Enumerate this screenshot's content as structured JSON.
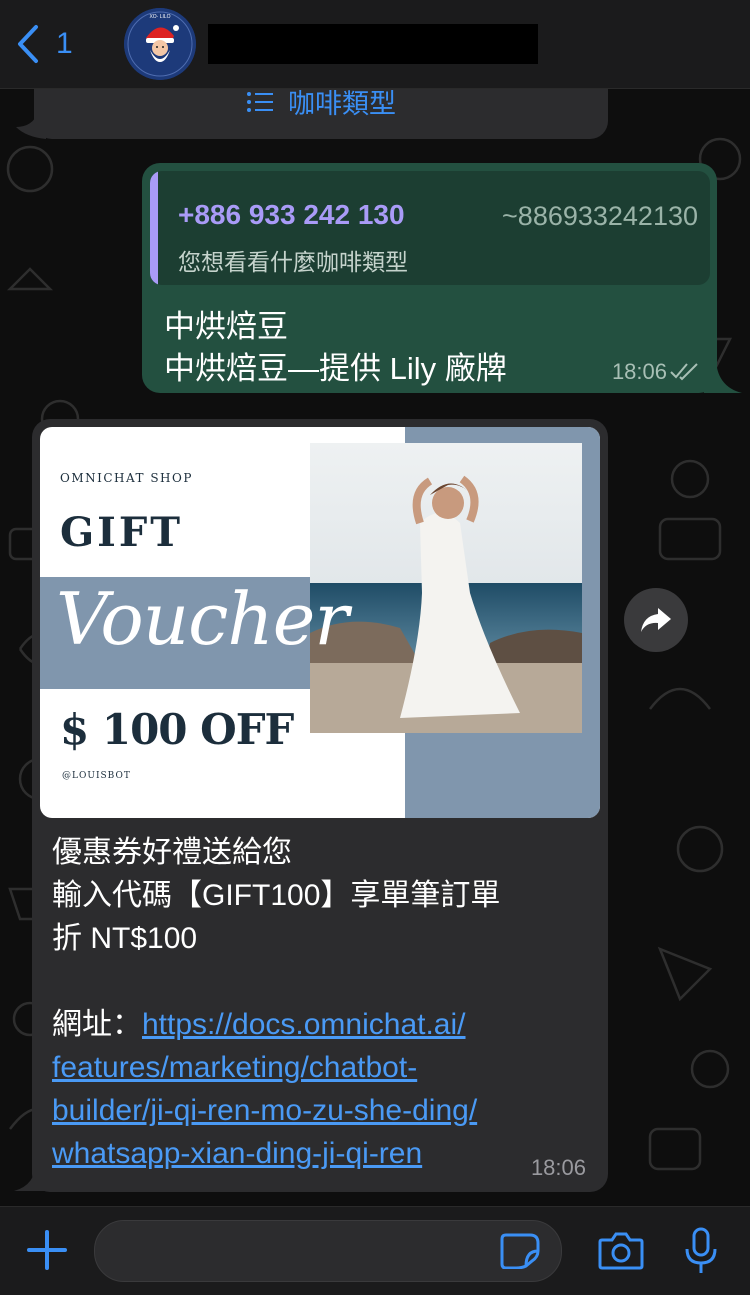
{
  "header": {
    "back_count": "1",
    "avatar_text": "XO· LILO",
    "accent": "#3a8ff5"
  },
  "top_bubble": {
    "menu_label": "咖啡類型",
    "icon": "list-icon"
  },
  "sent_message": {
    "quote_phone": "+886 933 242 130",
    "quote_alias": "~886933242130",
    "quote_text": "您想看看什麼咖啡類型",
    "line1": "中烘焙豆",
    "line2": "中烘焙豆—提供 Lily 廠牌",
    "time": "18:06",
    "status_icon": "double-check-icon",
    "bubble_color": "#235040",
    "quote_accent": "#a99bf7"
  },
  "received_message": {
    "voucher": {
      "shop": "OMNICHAT SHOP",
      "gift": "GIFT",
      "script": "Voucher",
      "off": "$ 100 OFF",
      "handle": "@LOUISBOT"
    },
    "line1": "優惠券好禮送給您",
    "line2": "輸入代碼【GIFT100】享單筆訂單",
    "line3": "折 NT$100",
    "url_label": "網址：",
    "url_line1": "https://docs.omnichat.ai/",
    "url_line2": "features/marketing/chatbot-",
    "url_line3": "builder/ji-qi-ren-mo-zu-she-ding/",
    "url_line4": "whatsapp-xian-ding-ji-qi-ren",
    "time": "18:06",
    "link_color": "#4a9af5"
  },
  "forward_button": {
    "icon": "forward-icon"
  },
  "input_bar": {
    "placeholder": "",
    "icons": [
      "plus-icon",
      "sticker-icon",
      "camera-icon",
      "microphone-icon"
    ]
  }
}
